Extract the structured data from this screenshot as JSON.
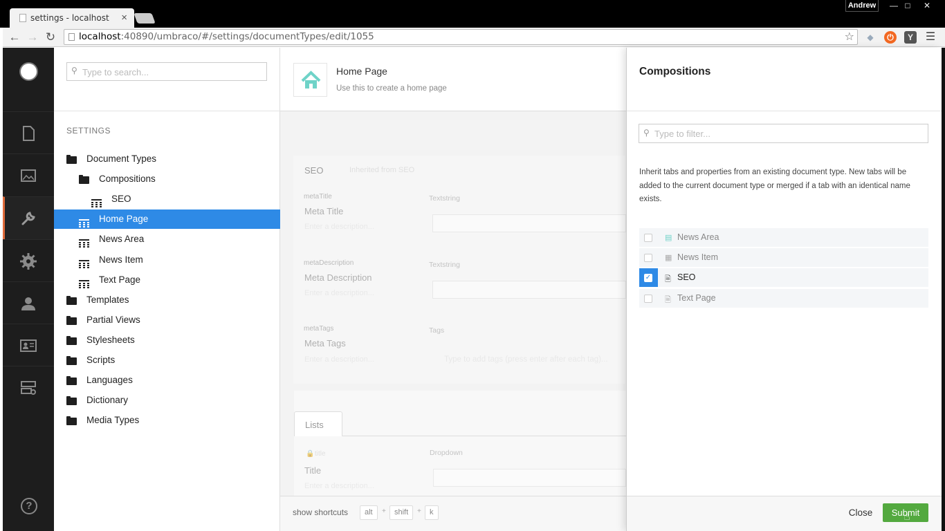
{
  "browser": {
    "tab_title": "settings - localhost",
    "tab_close": "×",
    "profile_name": "Andrew",
    "url_host": "localhost",
    "url_path": ":40890/umbraco/#/settings/documentTypes/edit/1055",
    "window_controls": [
      "—",
      "□",
      "✕"
    ]
  },
  "sections": [
    "content",
    "media",
    "settings",
    "developer",
    "users",
    "members",
    "forms"
  ],
  "tree": {
    "search_placeholder": "Type to search...",
    "heading": "SETTINGS",
    "nodes": [
      {
        "label": "Document Types",
        "icon": "folder-icon"
      },
      {
        "label": "Compositions",
        "icon": "folder-icon"
      },
      {
        "label": "SEO",
        "icon": "doc-type-icon"
      },
      {
        "label": "Home Page",
        "icon": "doc-type-icon",
        "selected": true
      },
      {
        "label": "News Area",
        "icon": "doc-type-icon"
      },
      {
        "label": "News Item",
        "icon": "doc-type-icon"
      },
      {
        "label": "Text Page",
        "icon": "doc-type-icon"
      },
      {
        "label": "Templates",
        "icon": "folder-icon"
      },
      {
        "label": "Partial Views",
        "icon": "folder-icon"
      },
      {
        "label": "Stylesheets",
        "icon": "folder-icon"
      },
      {
        "label": "Scripts",
        "icon": "folder-icon"
      },
      {
        "label": "Languages",
        "icon": "folder-icon"
      },
      {
        "label": "Dictionary",
        "icon": "folder-icon"
      },
      {
        "label": "Media Types",
        "icon": "folder-icon"
      }
    ]
  },
  "editor": {
    "name": "Home Page",
    "description": "Use this to create a home page",
    "group_tab": "SEO",
    "inherited_tab": "Inherited from SEO",
    "properties": [
      {
        "alias": "metaTitle",
        "label": "Meta Title",
        "desc": "Enter a description...",
        "editor": "Textstring"
      },
      {
        "alias": "metaDescription",
        "label": "Meta Description",
        "desc": "Enter a description...",
        "editor": "Textstring"
      },
      {
        "alias": "metaTags",
        "label": "Meta Tags",
        "desc": "Enter a description...",
        "editor": "Tags"
      }
    ],
    "tags_placeholder": "Type to add tags (press enter after each tag)...",
    "lists_tab": "Lists",
    "list_property": {
      "alias": "title",
      "label": "Title",
      "desc": "Enter a description...",
      "editor": "Dropdown"
    },
    "shortcuts_label": "show shortcuts",
    "shortcut_keys": [
      "alt",
      "shift",
      "k"
    ]
  },
  "dialog": {
    "title": "Compositions",
    "filter_placeholder": "Type to filter...",
    "description": "Inherit tabs and properties from an existing document type. New tabs will be added to the current document type or merged if a tab with an identical name exists.",
    "items": [
      {
        "label": "News Area",
        "checked": false
      },
      {
        "label": "News Item",
        "checked": false
      },
      {
        "label": "SEO",
        "checked": true
      },
      {
        "label": "Text Page",
        "checked": false
      }
    ],
    "close_label": "Close",
    "submit_label": "Submit"
  },
  "colors": {
    "accent_blue": "#2e8ae6",
    "submit_green": "#53a93f",
    "section_active": "#e06a3a",
    "home_icon": "#6fd3c8"
  }
}
